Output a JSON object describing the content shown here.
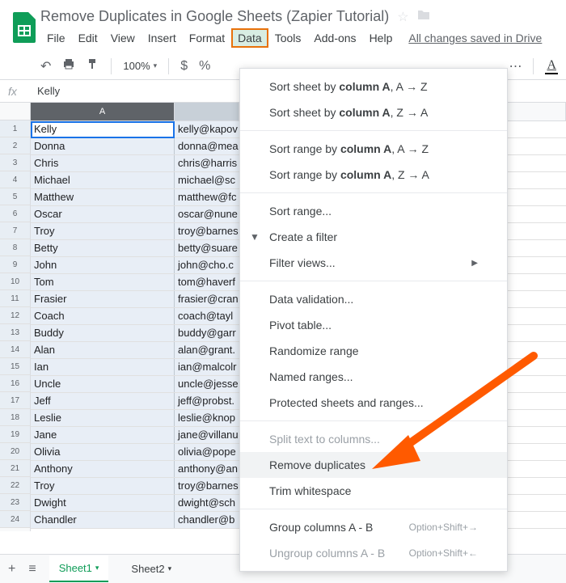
{
  "doc": {
    "title": "Remove Duplicates in Google Sheets (Zapier Tutorial)",
    "save_status": "All changes saved in Drive"
  },
  "menubar": [
    "File",
    "Edit",
    "View",
    "Insert",
    "Format",
    "Data",
    "Tools",
    "Add-ons",
    "Help"
  ],
  "active_menu_index": 5,
  "toolbar": {
    "zoom": "100%",
    "currency": "$",
    "percent": "%"
  },
  "fx": {
    "value": "Kelly"
  },
  "columns": {
    "A": "A",
    "B_partial": ""
  },
  "rows": [
    {
      "n": "1",
      "a": "Kelly",
      "b": "kelly@kapov"
    },
    {
      "n": "2",
      "a": "Donna",
      "b": "donna@mea"
    },
    {
      "n": "3",
      "a": "Chris",
      "b": "chris@harris"
    },
    {
      "n": "4",
      "a": "Michael",
      "b": "michael@sc"
    },
    {
      "n": "5",
      "a": "Matthew",
      "b": "matthew@fc"
    },
    {
      "n": "6",
      "a": "Oscar",
      "b": "oscar@nune"
    },
    {
      "n": "7",
      "a": "Troy",
      "b": "troy@barnes"
    },
    {
      "n": "8",
      "a": "Betty",
      "b": "betty@suare"
    },
    {
      "n": "9",
      "a": "John",
      "b": "john@cho.c"
    },
    {
      "n": "10",
      "a": "Tom",
      "b": "tom@haverf"
    },
    {
      "n": "11",
      "a": "Frasier",
      "b": "frasier@cran"
    },
    {
      "n": "12",
      "a": "Coach",
      "b": "coach@tayl"
    },
    {
      "n": "13",
      "a": "Buddy",
      "b": "buddy@garr"
    },
    {
      "n": "14",
      "a": "Alan",
      "b": "alan@grant."
    },
    {
      "n": "15",
      "a": "Ian",
      "b": "ian@malcolr"
    },
    {
      "n": "16",
      "a": "Uncle",
      "b": "uncle@jesse"
    },
    {
      "n": "17",
      "a": "Jeff",
      "b": "jeff@probst."
    },
    {
      "n": "18",
      "a": "Leslie",
      "b": "leslie@knop"
    },
    {
      "n": "19",
      "a": "Jane",
      "b": "jane@villanu"
    },
    {
      "n": "20",
      "a": "Olivia",
      "b": "olivia@pope"
    },
    {
      "n": "21",
      "a": "Anthony",
      "b": "anthony@an"
    },
    {
      "n": "22",
      "a": "Troy",
      "b": "troy@barnes"
    },
    {
      "n": "23",
      "a": "Dwight",
      "b": "dwight@sch"
    },
    {
      "n": "24",
      "a": "Chandler",
      "b": "chandler@b"
    }
  ],
  "dropdown": {
    "sort_sheet_az": {
      "prefix": "Sort sheet by ",
      "col": "column A",
      "suffix": ", A → Z"
    },
    "sort_sheet_za": {
      "prefix": "Sort sheet by ",
      "col": "column A",
      "suffix": ", Z → A"
    },
    "sort_range_az": {
      "prefix": "Sort range by ",
      "col": "column A",
      "suffix": ", A → Z"
    },
    "sort_range_za": {
      "prefix": "Sort range by ",
      "col": "column A",
      "suffix": ", Z → A"
    },
    "sort_range": "Sort range...",
    "create_filter": "Create a filter",
    "filter_views": "Filter views...",
    "data_validation": "Data validation...",
    "pivot_table": "Pivot table...",
    "randomize": "Randomize range",
    "named_ranges": "Named ranges...",
    "protected": "Protected sheets and ranges...",
    "split_text": "Split text to columns...",
    "remove_dup": "Remove duplicates",
    "trim": "Trim whitespace",
    "group": {
      "label": "Group columns A - B",
      "shortcut": "Option+Shift+→"
    },
    "ungroup": {
      "label": "Ungroup columns A - B",
      "shortcut": "Option+Shift+←"
    }
  },
  "tabs": {
    "add": "+",
    "sheet1": "Sheet1",
    "sheet2": "Sheet2"
  }
}
